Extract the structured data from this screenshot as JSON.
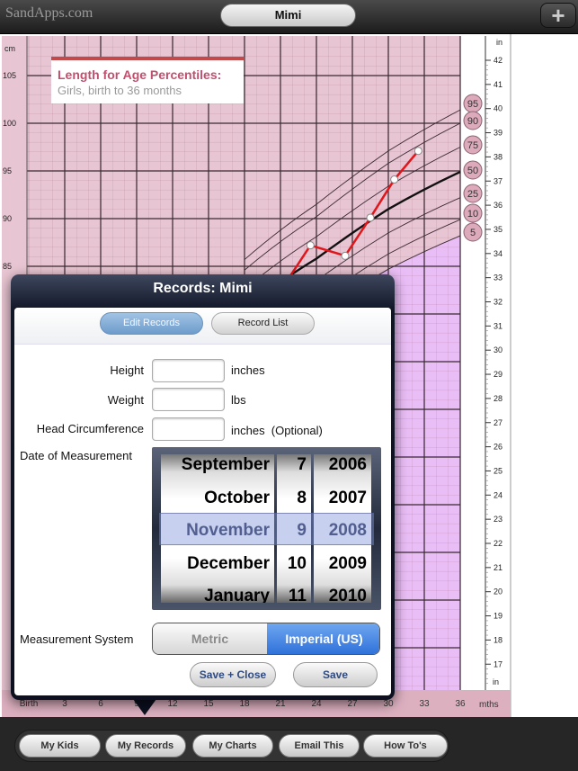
{
  "topbar": {
    "brand": "SandApps.com",
    "child_name": "Mimi",
    "add_icon": "plus-icon"
  },
  "chart_data": {
    "type": "line",
    "title": "Length for Age Percentiles:",
    "subtitle": "Girls, birth to 36 months",
    "xlabel": "mths",
    "ylabel_left": "cm",
    "ylabel_right": "in",
    "x_ticks": [
      "Birth",
      "3",
      "6",
      "9",
      "12",
      "15",
      "18",
      "21",
      "24",
      "27",
      "30",
      "33",
      "36"
    ],
    "y_ticks_cm": [
      "105",
      "100",
      "95",
      "90",
      "85"
    ],
    "y_ticks_in": [
      "42",
      "41",
      "40",
      "39",
      "38",
      "37",
      "36",
      "35",
      "34",
      "33",
      "32",
      "31",
      "30",
      "29",
      "28",
      "27",
      "26",
      "25",
      "24",
      "23",
      "22",
      "21",
      "20",
      "19",
      "18",
      "17"
    ],
    "xlim": [
      0,
      36
    ],
    "grid": true,
    "percentile_months": [
      18,
      24,
      30,
      36
    ],
    "percentiles": [
      {
        "name": "95",
        "values": [
          85.7,
          91.5,
          97.1,
          101.4
        ]
      },
      {
        "name": "90",
        "values": [
          84.6,
          90.2,
          95.8,
          100.0
        ]
      },
      {
        "name": "75",
        "values": [
          82.6,
          88.1,
          93.4,
          97.5
        ]
      },
      {
        "name": "50",
        "values": [
          80.5,
          85.8,
          91.0,
          94.9
        ]
      },
      {
        "name": "25",
        "values": [
          78.3,
          83.5,
          88.5,
          92.2
        ]
      },
      {
        "name": "10",
        "values": [
          76.5,
          81.4,
          86.3,
          89.9
        ]
      },
      {
        "name": "5",
        "values": [
          75.1,
          80.0,
          84.7,
          88.2
        ]
      }
    ],
    "measurements": {
      "months": [
        23.5,
        26.4,
        28.5,
        30.5,
        32.5
      ],
      "cm": [
        87.2,
        86.1,
        90.1,
        94.1,
        97.1
      ]
    },
    "colors": {
      "background": "#e8c5d2",
      "below_5th": "#e9bdf5",
      "measurement_line": "#e0161b",
      "median_line": "#111111"
    }
  },
  "modal": {
    "title": "Records: Mimi",
    "tabs": [
      {
        "label": "Edit Records",
        "active": true
      },
      {
        "label": "Record List",
        "active": false
      }
    ],
    "fields": [
      {
        "label": "Height",
        "value": "",
        "unit": "inches"
      },
      {
        "label": "Weight",
        "value": "",
        "unit": "lbs"
      },
      {
        "label": "Head Circumference",
        "value": "",
        "unit": "inches  (Optional)"
      }
    ],
    "date_label": "Date of Measurement",
    "picker": {
      "months": [
        "September",
        "October",
        "November",
        "December",
        "January"
      ],
      "days": [
        "7",
        "8",
        "9",
        "10",
        "11"
      ],
      "years": [
        "2006",
        "2007",
        "2008",
        "2009",
        "2010"
      ],
      "selected": {
        "month": "November",
        "day": "9",
        "year": "2008"
      }
    },
    "measurement_label": "Measurement System",
    "systems": [
      {
        "label": "Metric",
        "selected": false
      },
      {
        "label": "Imperial (US)",
        "selected": true
      }
    ],
    "save_close": "Save + Close",
    "save": "Save"
  },
  "toolbar": {
    "buttons": [
      "My Kids",
      "My Records",
      "My Charts",
      "Email This",
      "How To's"
    ]
  }
}
